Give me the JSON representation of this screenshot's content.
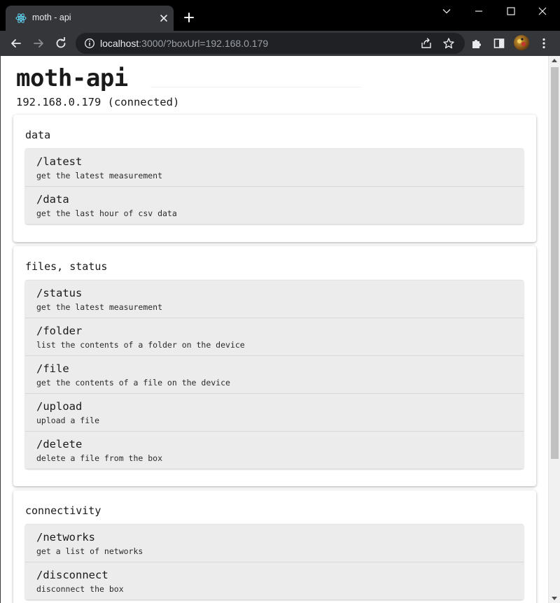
{
  "browser": {
    "tab_title": "moth - api",
    "url_host": "localhost",
    "url_rest": ":3000/?boxUrl=192.168.0.179"
  },
  "icons": {
    "favicon": "react-icon",
    "tab_close": "close-icon",
    "new_tab": "plus-icon",
    "back": "arrow-left-icon",
    "forward": "arrow-right-icon",
    "reload": "reload-icon",
    "site_info": "info-icon",
    "share": "share-icon",
    "bookmark": "star-icon",
    "extensions": "puzzle-icon",
    "side_panel": "side-panel-icon",
    "menu": "kebab-menu-icon"
  },
  "page": {
    "title": "moth-api",
    "connection": "192.168.0.179 (connected)"
  },
  "sections": [
    {
      "title": "data",
      "endpoints": [
        {
          "path": "/latest",
          "desc": "get the latest measurement"
        },
        {
          "path": "/data",
          "desc": "get the last hour of csv data"
        }
      ]
    },
    {
      "title": "files, status",
      "endpoints": [
        {
          "path": "/status",
          "desc": "get the latest measurement"
        },
        {
          "path": "/folder",
          "desc": "list the contents of a folder on the device"
        },
        {
          "path": "/file",
          "desc": "get the contents of a file on the device"
        },
        {
          "path": "/upload",
          "desc": "upload a file"
        },
        {
          "path": "/delete",
          "desc": "delete a file from the box"
        }
      ]
    },
    {
      "title": "connectivity",
      "endpoints": [
        {
          "path": "/networks",
          "desc": "get a list of networks"
        },
        {
          "path": "/disconnect",
          "desc": "disconnect the box"
        }
      ]
    }
  ]
}
